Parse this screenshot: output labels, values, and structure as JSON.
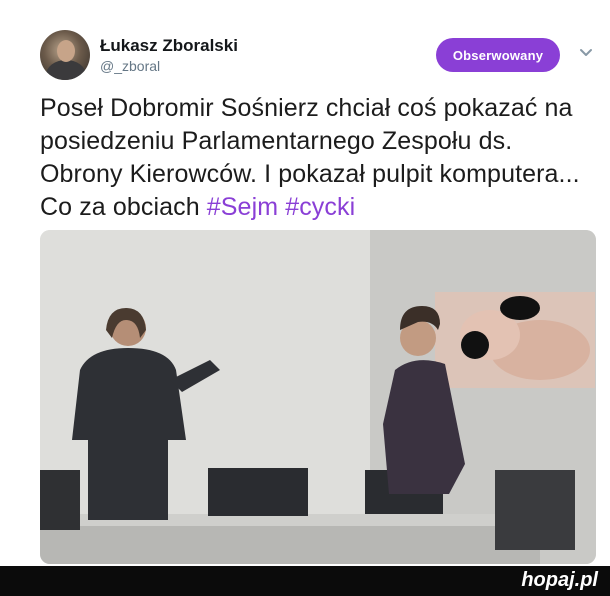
{
  "tweet": {
    "author_name": "Łukasz Zboralski",
    "author_handle": "@_zboral",
    "follow_label": "Obserwowany",
    "text_plain": "Poseł Dobromir Sośnierz chciał coś pokazać na posiedzeniu Parlamentarnego Zespołu ds. Obrony Kierowców. I pokazał pulpit komputera... Co za obciach ",
    "hashtag1": "#Sejm",
    "hashtag2": "#cycki"
  },
  "footer": {
    "brand": "hopaj.pl"
  },
  "colors": {
    "accent": "#8a3fd6",
    "text": "#1c1c1c",
    "muted": "#657786",
    "footer_bg": "#0b0b0b"
  },
  "icons": {
    "menu": "chevron-down-icon"
  }
}
